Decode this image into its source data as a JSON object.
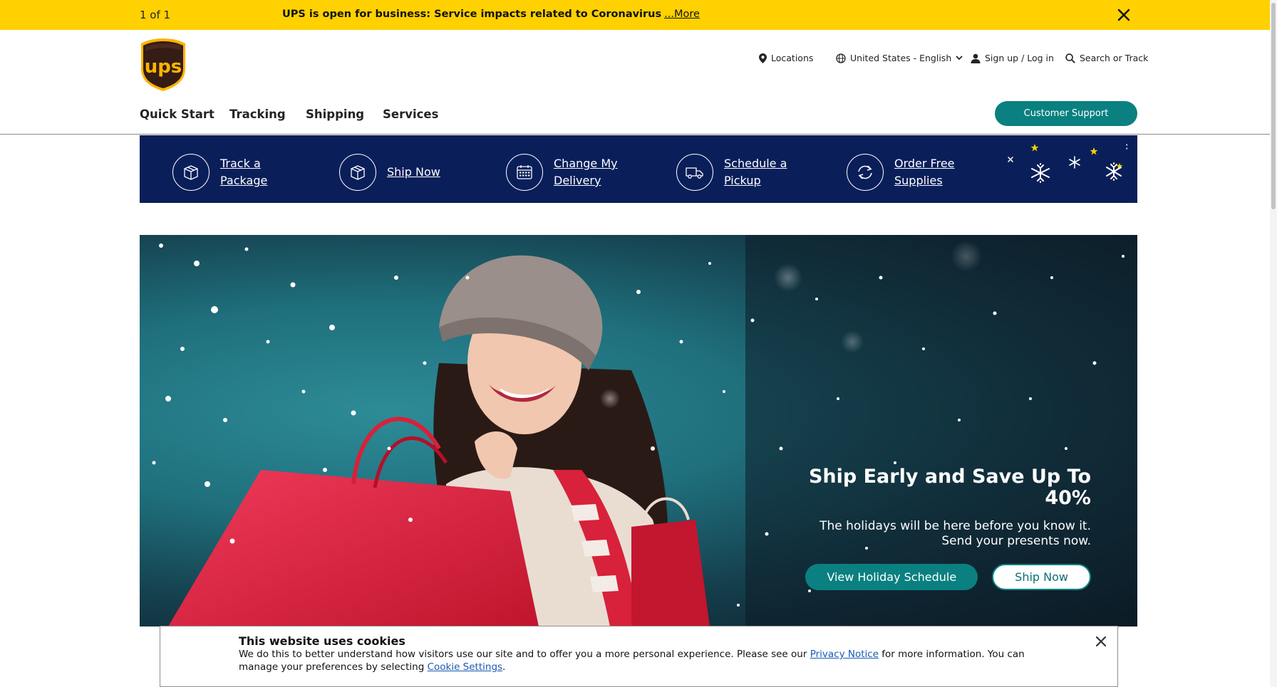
{
  "alert": {
    "counter": "1 of 1",
    "message": "UPS is open for business: Service impacts related to Coronavirus",
    "more_link": "...More"
  },
  "header": {
    "logo_text": "ups",
    "utility": {
      "locations": "Locations",
      "language": "United States - English",
      "login": "Sign up / Log in",
      "search": "Search or Track"
    },
    "nav": [
      "Quick Start",
      "Tracking",
      "Shipping",
      "Services"
    ],
    "support_button": "Customer Support"
  },
  "quick_start": [
    {
      "label": "Track a\nPackage",
      "icon": "package-icon"
    },
    {
      "label": "Ship Now",
      "icon": "package-icon"
    },
    {
      "label": "Change My\nDelivery",
      "icon": "calendar-icon"
    },
    {
      "label": "Schedule a\nPickup",
      "icon": "truck-icon"
    },
    {
      "label": "Order Free\nSupplies",
      "icon": "refresh-icon"
    }
  ],
  "hero": {
    "title": "Ship Early and Save Up To 40%",
    "subtitle_line1": "The holidays will be here before you know it.",
    "subtitle_line2": "Send your presents now.",
    "primary_button": "View Holiday Schedule",
    "secondary_button": "Ship Now"
  },
  "cookie": {
    "title": "This website uses cookies",
    "text_before": "We do this to better understand how visitors use our site and to offer you a more personal experience. Please see our ",
    "privacy_link": "Privacy Notice",
    "text_middle": " for more information. You can manage your preferences by selecting ",
    "settings_link": "Cookie Settings",
    "text_after": "."
  },
  "colors": {
    "alert_yellow": "#ffd100",
    "brand_teal": "#0a8080",
    "quickbar_navy": "#0a1f5a",
    "ups_brown": "#351c15",
    "ups_gold": "#ffb500"
  }
}
